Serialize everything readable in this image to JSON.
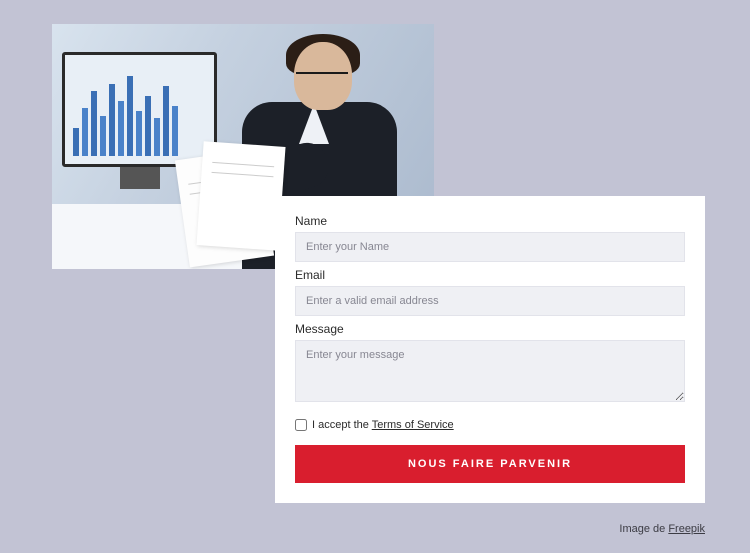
{
  "image": {
    "semantic": "businessman-reviewing-chart-printouts-at-desk"
  },
  "form": {
    "name_label": "Name",
    "name_placeholder": "Enter your Name",
    "email_label": "Email",
    "email_placeholder": "Enter a valid email address",
    "message_label": "Message",
    "message_placeholder": "Enter your message",
    "consent_prefix": "I accept the ",
    "consent_link": "Terms of Service",
    "submit_label": "NOUS FAIRE PARVENIR"
  },
  "attribution": {
    "prefix": "Image de ",
    "source": "Freepik"
  },
  "colors": {
    "page_bg": "#c2c3d4",
    "card_bg": "#ffffff",
    "input_bg": "#eff0f4",
    "accent": "#d91e2e"
  }
}
